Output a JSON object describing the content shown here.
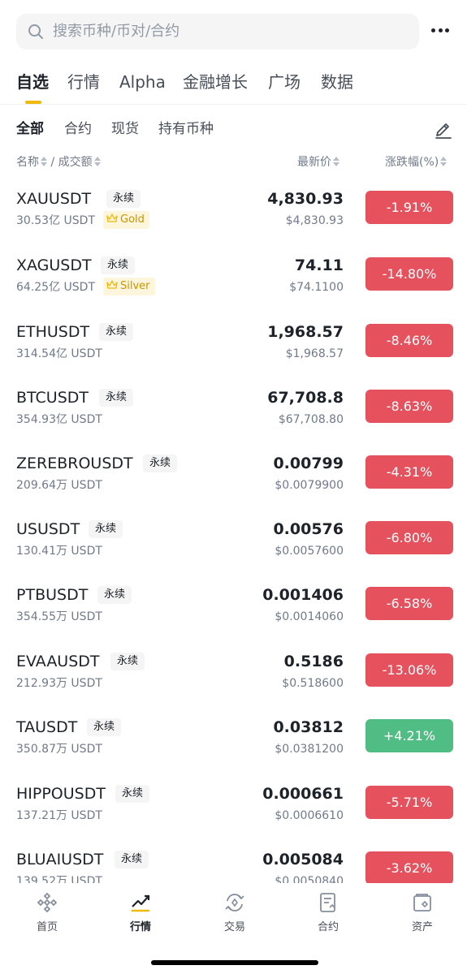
{
  "search": {
    "placeholder": "搜索币种/币对/合约"
  },
  "main_tabs": [
    {
      "label": "自选",
      "active": true
    },
    {
      "label": "行情"
    },
    {
      "label": "Alpha"
    },
    {
      "label": "金融增长"
    },
    {
      "label": "广场"
    },
    {
      "label": "数据"
    }
  ],
  "sub_tabs": [
    {
      "label": "全部",
      "active": true
    },
    {
      "label": "合约"
    },
    {
      "label": "现货"
    },
    {
      "label": "持有币种"
    }
  ],
  "columns": {
    "name": "名称",
    "separator": "/",
    "volume": "成交额",
    "price": "最新价",
    "change": "涨跌幅(%)"
  },
  "rows": [
    {
      "symbol": "XAUUSDT",
      "tag": "永续",
      "volume": "30.53亿 USDT",
      "badge": "Gold",
      "price": "4,830.93",
      "fiat": "$4,830.93",
      "change": "-1.91%",
      "direction": "down"
    },
    {
      "symbol": "XAGUSDT",
      "tag": "永续",
      "volume": "64.25亿 USDT",
      "badge": "Silver",
      "price": "74.11",
      "fiat": "$74.1100",
      "change": "-14.80%",
      "direction": "down"
    },
    {
      "symbol": "ETHUSDT",
      "tag": "永续",
      "volume": "314.54亿 USDT",
      "price": "1,968.57",
      "fiat": "$1,968.57",
      "change": "-8.46%",
      "direction": "down"
    },
    {
      "symbol": "BTCUSDT",
      "tag": "永续",
      "volume": "354.93亿 USDT",
      "price": "67,708.8",
      "fiat": "$67,708.80",
      "change": "-8.63%",
      "direction": "down"
    },
    {
      "symbol": "ZEREBROUSDT",
      "tag": "永续",
      "volume": "209.64万 USDT",
      "price": "0.00799",
      "fiat": "$0.0079900",
      "change": "-4.31%",
      "direction": "down"
    },
    {
      "symbol": "USUSDT",
      "tag": "永续",
      "volume": "130.41万 USDT",
      "price": "0.00576",
      "fiat": "$0.0057600",
      "change": "-6.80%",
      "direction": "down"
    },
    {
      "symbol": "PTBUSDT",
      "tag": "永续",
      "volume": "354.55万 USDT",
      "price": "0.001406",
      "fiat": "$0.0014060",
      "change": "-6.58%",
      "direction": "down"
    },
    {
      "symbol": "EVAAUSDT",
      "tag": "永续",
      "volume": "212.93万 USDT",
      "price": "0.5186",
      "fiat": "$0.518600",
      "change": "-13.06%",
      "direction": "down"
    },
    {
      "symbol": "TAUSDT",
      "tag": "永续",
      "volume": "350.87万 USDT",
      "price": "0.03812",
      "fiat": "$0.0381200",
      "change": "+4.21%",
      "direction": "up"
    },
    {
      "symbol": "HIPPOUSDT",
      "tag": "永续",
      "volume": "137.21万 USDT",
      "price": "0.000661",
      "fiat": "$0.0006610",
      "change": "-5.71%",
      "direction": "down"
    },
    {
      "symbol": "BLUAIUSDT",
      "tag": "永续",
      "volume": "139.52万 USDT",
      "price": "0.005084",
      "fiat": "$0.0050840",
      "change": "-3.62%",
      "direction": "down"
    }
  ],
  "bottom_nav": [
    {
      "label": "首页",
      "icon": "home-diamond-icon"
    },
    {
      "label": "行情",
      "icon": "market-chart-icon",
      "active": true
    },
    {
      "label": "交易",
      "icon": "trade-swap-icon"
    },
    {
      "label": "合约",
      "icon": "futures-document-icon"
    },
    {
      "label": "资产",
      "icon": "wallet-icon"
    }
  ],
  "colors": {
    "accent": "#f0b90b",
    "down": "#e5525e",
    "up": "#4fbd84"
  }
}
